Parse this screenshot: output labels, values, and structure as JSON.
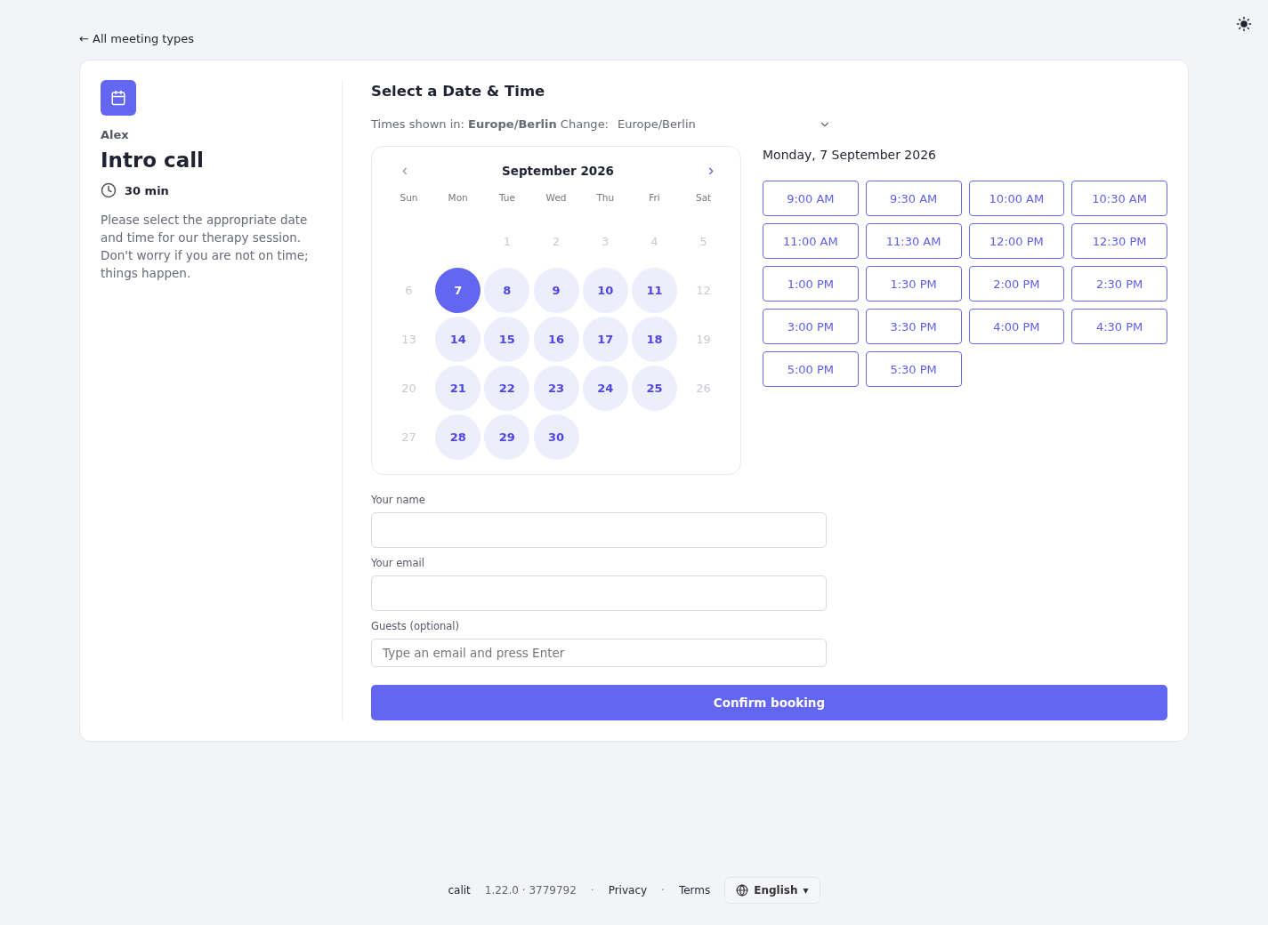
{
  "back_link": "← All meeting types",
  "host": "Alex",
  "title": "Intro call",
  "duration": "30 min",
  "description": "Please select the appropriate date and time for our therapy session. Don't worry if you are not on time; things happen.",
  "heading": "Select a Date & Time",
  "timezone": {
    "prefix": "Times shown in: **Europe/Berlin** Change:",
    "value": "Europe/Berlin"
  },
  "calendar": {
    "month": "September 2026",
    "prev": "‹",
    "next": "›",
    "weekdays": [
      "Sun",
      "Mon",
      "Tue",
      "Wed",
      "Thu",
      "Fri",
      "Sat"
    ],
    "weeks": [
      [
        {
          "label": "1",
          "available": false,
          "selected": false
        },
        {
          "label": "2",
          "available": false,
          "selected": false
        },
        {
          "label": "3",
          "available": false,
          "selected": false
        },
        {
          "label": "4",
          "available": false,
          "selected": false
        },
        {
          "label": "5",
          "available": false,
          "selected": false
        }
      ],
      [
        {
          "label": "6",
          "available": false,
          "selected": false
        },
        {
          "label": "7",
          "available": true,
          "selected": true
        },
        {
          "label": "8",
          "available": true,
          "selected": false
        },
        {
          "label": "9",
          "available": true,
          "selected": false
        },
        {
          "label": "10",
          "available": true,
          "selected": false
        },
        {
          "label": "11",
          "available": true,
          "selected": false
        },
        {
          "label": "12",
          "available": false,
          "selected": false
        }
      ],
      [
        {
          "label": "13",
          "available": false,
          "selected": false
        },
        {
          "label": "14",
          "available": true,
          "selected": false
        },
        {
          "label": "15",
          "available": true,
          "selected": false
        },
        {
          "label": "16",
          "available": true,
          "selected": false
        },
        {
          "label": "17",
          "available": true,
          "selected": false
        },
        {
          "label": "18",
          "available": true,
          "selected": false
        },
        {
          "label": "19",
          "available": false,
          "selected": false
        }
      ],
      [
        {
          "label": "20",
          "available": false,
          "selected": false
        },
        {
          "label": "21",
          "available": true,
          "selected": false
        },
        {
          "label": "22",
          "available": true,
          "selected": false
        },
        {
          "label": "23",
          "available": true,
          "selected": false
        },
        {
          "label": "24",
          "available": true,
          "selected": false
        },
        {
          "label": "25",
          "available": true,
          "selected": false
        },
        {
          "label": "26",
          "available": false,
          "selected": false
        }
      ],
      [
        {
          "label": "27",
          "available": false,
          "selected": false
        },
        {
          "label": "28",
          "available": true,
          "selected": false
        },
        {
          "label": "29",
          "available": true,
          "selected": false
        },
        {
          "label": "30",
          "available": true,
          "selected": false
        }
      ]
    ]
  },
  "selected_date": "Monday, 7 September 2026",
  "slots": [
    "9:00 AM",
    "9:30 AM",
    "10:00 AM",
    "10:30 AM",
    "11:00 AM",
    "11:30 AM",
    "12:00 PM",
    "12:30 PM",
    "1:00 PM",
    "1:30 PM",
    "2:00 PM",
    "2:30 PM",
    "3:00 PM",
    "3:30 PM",
    "4:00 PM",
    "4:30 PM",
    "5:00 PM",
    "5:30 PM"
  ],
  "form": [
    {
      "label": "Your name"
    },
    {
      "label": "Your email"
    },
    {
      "label": "Guests (optional)",
      "placeholder": "Type an email and press Enter"
    }
  ],
  "confirm": "Confirm booking",
  "footer": {
    "brand": "calit",
    "version": "1.22.0 · 3779792",
    "sep1": "·",
    "privacy": "Privacy",
    "sep2": "·",
    "terms": "Terms",
    "language": "English",
    "caret": "▾"
  }
}
